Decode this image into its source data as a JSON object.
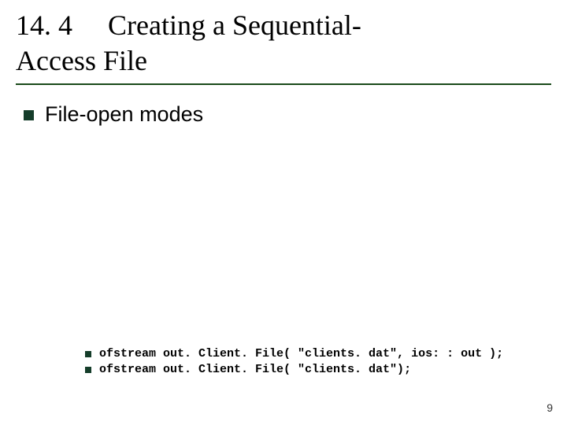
{
  "title": {
    "line1": "14. 4  Creating a Sequential-",
    "line2": "Access File"
  },
  "bullets": {
    "main": "File-open modes"
  },
  "code": {
    "line1": "ofstream out. Client. File( \"clients. dat\", ios: : out );",
    "line2": "ofstream out. Client. File( \"clients. dat\");"
  },
  "page_number": "9"
}
